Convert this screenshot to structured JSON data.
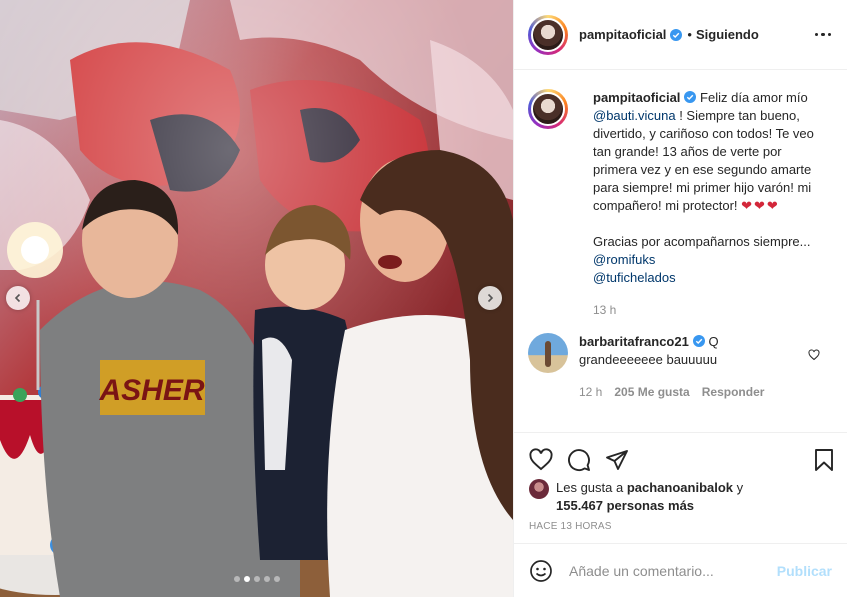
{
  "header": {
    "username": "pampitaoficial",
    "separator": "•",
    "follow_status": "Siguiendo",
    "verified_icon": "verified-badge-icon",
    "more_icon": "more-options-icon"
  },
  "caption": {
    "username": "pampitaoficial",
    "text_1": "Feliz día amor mío ",
    "mention_1": "@bauti.vicuna",
    "text_2": " ! Siempre tan bueno, divertido, y cariñoso con todos! Te veo tan grande! 13 años de verte por primera vez y en ese segundo amarte para siempre! mi primer hijo varón! mi compañero! mi protector! ",
    "hearts": "❤❤❤",
    "text_3": "Gracias por acompañarnos siempre...",
    "mention_2": "@romifuks",
    "mention_3": "@tufichelados",
    "time": "13 h"
  },
  "comment": {
    "username": "barbaritafranco21",
    "text": "Q grandeeeeeee bauuuuu",
    "time": "12 h",
    "likes": "205 Me gusta",
    "reply": "Responder"
  },
  "likes": {
    "prefix": "Les gusta a ",
    "user": "pachanoanibalok",
    "middle": " y",
    "count": "155.467 personas más"
  },
  "time_ago": "HACE 13 HORAS",
  "add_comment": {
    "placeholder": "Añade un comentario...",
    "publish": "Publicar"
  },
  "carousel": {
    "slides": 5,
    "active_index": 1
  },
  "colors": {
    "verified": "#3897f0",
    "mention": "#00376b",
    "publish_disabled": "#b2dffc",
    "heart_red": "#d3273a"
  }
}
